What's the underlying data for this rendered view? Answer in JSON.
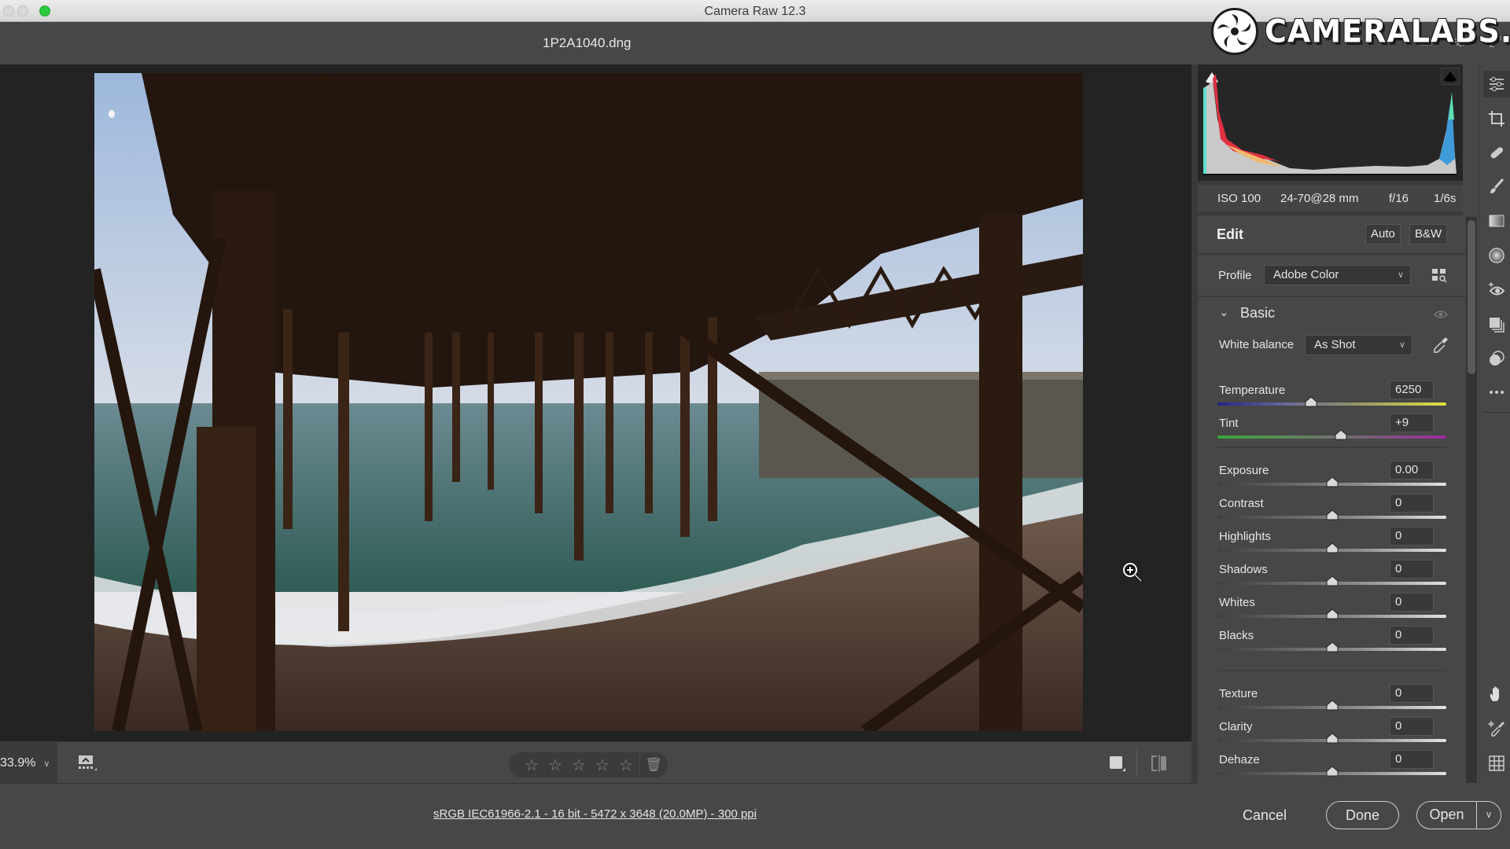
{
  "window": {
    "title": "Camera Raw 12.3"
  },
  "header": {
    "filename": "1P2A1040.dng"
  },
  "watermark": {
    "text": "CAMERALABS.COM"
  },
  "histogram": {
    "exif": {
      "iso": "ISO 100",
      "lens": "24-70@28 mm",
      "aperture": "f/16",
      "shutter": "1/6s"
    }
  },
  "edit": {
    "title": "Edit",
    "auto_label": "Auto",
    "bw_label": "B&W",
    "profile_label": "Profile",
    "profile_value": "Adobe Color",
    "section_title": "Basic",
    "white_balance_label": "White balance",
    "white_balance_value": "As Shot",
    "sliders": [
      {
        "label": "Temperature",
        "value": "6250",
        "position": 0.41,
        "track": "temp"
      },
      {
        "label": "Tint",
        "value": "+9",
        "position": 0.54,
        "track": "tint"
      },
      {
        "label": "Exposure",
        "value": "0.00",
        "position": 0.5,
        "track": "neutral"
      },
      {
        "label": "Contrast",
        "value": "0",
        "position": 0.5,
        "track": "neutral"
      },
      {
        "label": "Highlights",
        "value": "0",
        "position": 0.5,
        "track": "neutral"
      },
      {
        "label": "Shadows",
        "value": "0",
        "position": 0.5,
        "track": "neutral"
      },
      {
        "label": "Whites",
        "value": "0",
        "position": 0.5,
        "track": "neutral"
      },
      {
        "label": "Blacks",
        "value": "0",
        "position": 0.5,
        "track": "neutral"
      },
      {
        "label": "Texture",
        "value": "0",
        "position": 0.5,
        "track": "neutral"
      },
      {
        "label": "Clarity",
        "value": "0",
        "position": 0.5,
        "track": "neutral"
      },
      {
        "label": "Dehaze",
        "value": "0",
        "position": 0.5,
        "track": "neutral"
      }
    ]
  },
  "toolbar": {
    "zoom_level": "33.9%",
    "rating_stars": 5,
    "rating_value": 0
  },
  "tools": [
    "edit-sliders-icon",
    "crop-rotate-icon",
    "healing-bandage-icon",
    "adjustment-brush-icon",
    "graduated-filter-icon",
    "radial-filter-icon",
    "red-eye-icon",
    "snapshots-icon",
    "presets-icon",
    "more-icon",
    "hand-icon",
    "color-sampler-icon",
    "grid-icon"
  ],
  "footer": {
    "workflow_options": "sRGB IEC61966-2.1 - 16 bit - 5472 x 3648 (20.0MP) - 300 ppi",
    "cancel_label": "Cancel",
    "done_label": "Done",
    "open_label": "Open"
  }
}
